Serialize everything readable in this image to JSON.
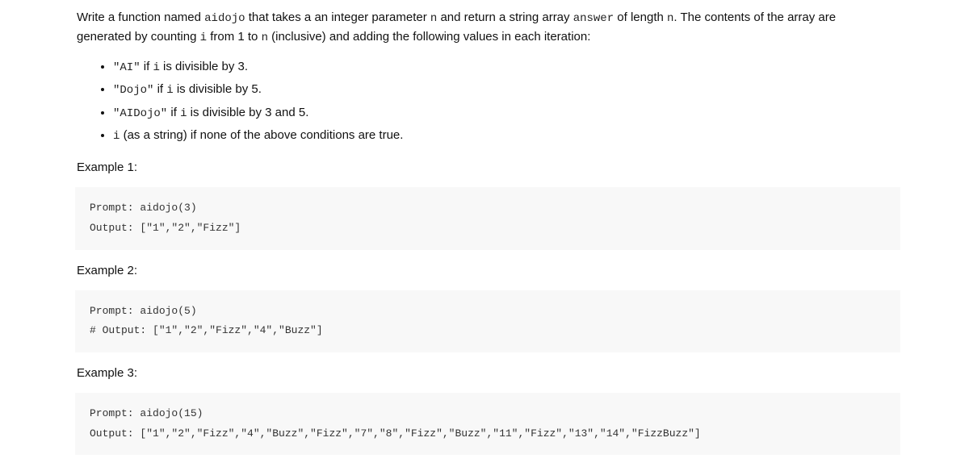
{
  "intro": {
    "p1a": "Write a function named ",
    "fn": "aidojo",
    "p1b": " that takes a an integer parameter ",
    "param": "n",
    "p1c": " and return a string array ",
    "ans": "answer",
    "p1d": " of length ",
    "param2": "n",
    "p1e": ". The contents of the array are generated by counting ",
    "i": "i",
    "p1f": " from 1 to ",
    "param3": "n",
    "p1g": " (inclusive) and adding the following values in each iteration:"
  },
  "rules": [
    {
      "code": "\"AI\"",
      "mid": " if ",
      "i": "i",
      "tail": " is divisible by 3."
    },
    {
      "code": "\"Dojo\"",
      "mid": " if ",
      "i": "i",
      "tail": " is divisible by 5."
    },
    {
      "code": "\"AIDojo\"",
      "mid": " if ",
      "i": "i",
      "tail": " is divisible by 3 and 5."
    },
    {
      "code": "i",
      "mid": " (as a string) if none of the above conditions are true.",
      "i": "",
      "tail": ""
    }
  ],
  "examples": [
    {
      "title": "Example 1:",
      "lines": [
        "Prompt: aidojo(3)",
        "Output: [\"1\",\"2\",\"Fizz\"]"
      ]
    },
    {
      "title": "Example 2:",
      "lines": [
        "Prompt: aidojo(5)",
        "# Output: [\"1\",\"2\",\"Fizz\",\"4\",\"Buzz\"]"
      ]
    },
    {
      "title": "Example 3:",
      "lines": [
        "Prompt: aidojo(15)",
        "Output: [\"1\",\"2\",\"Fizz\",\"4\",\"Buzz\",\"Fizz\",\"7\",\"8\",\"Fizz\",\"Buzz\",\"11\",\"Fizz\",\"13\",\"14\",\"FizzBuzz\"]"
      ]
    }
  ]
}
